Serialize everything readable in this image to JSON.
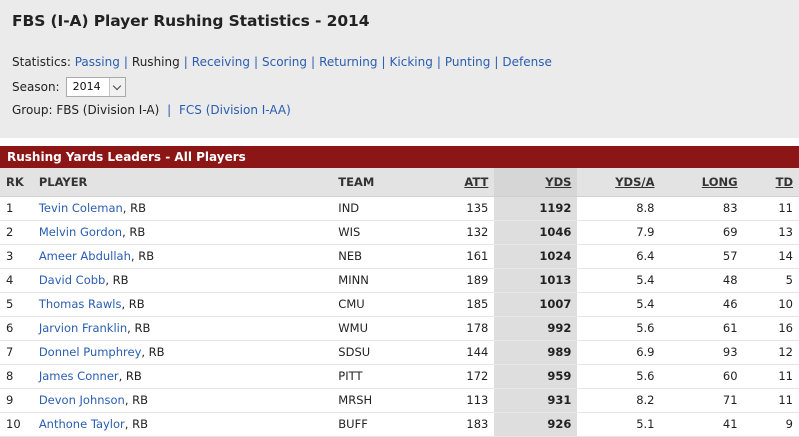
{
  "page_title": "FBS (I-A) Player Rushing Statistics - 2014",
  "statistics": {
    "label": "Statistics:",
    "links": [
      {
        "label": "Passing",
        "current": false
      },
      {
        "label": "Rushing",
        "current": true
      },
      {
        "label": "Receiving",
        "current": false
      },
      {
        "label": "Scoring",
        "current": false
      },
      {
        "label": "Returning",
        "current": false
      },
      {
        "label": "Kicking",
        "current": false
      },
      {
        "label": "Punting",
        "current": false
      },
      {
        "label": "Defense",
        "current": false
      }
    ],
    "separator": "|"
  },
  "season": {
    "label": "Season:",
    "selected": "2014"
  },
  "group": {
    "label": "Group:",
    "current": "FBS (Division I-A)",
    "separator": "|",
    "other": "FCS (Division I-AA)"
  },
  "section_title": "Rushing Yards Leaders - All Players",
  "table": {
    "columns": {
      "rk": "RK",
      "player": "PLAYER",
      "team": "TEAM",
      "att": "ATT",
      "yds": "YDS",
      "ydsa": "YDS/A",
      "long": "LONG",
      "td": "TD"
    },
    "rows": [
      {
        "rk": "1",
        "player": "Tevin Coleman",
        "pos": ", RB",
        "team": "IND",
        "att": "135",
        "yds": "1192",
        "ydsa": "8.8",
        "long": "83",
        "td": "11"
      },
      {
        "rk": "2",
        "player": "Melvin Gordon",
        "pos": ", RB",
        "team": "WIS",
        "att": "132",
        "yds": "1046",
        "ydsa": "7.9",
        "long": "69",
        "td": "13"
      },
      {
        "rk": "3",
        "player": "Ameer Abdullah",
        "pos": ", RB",
        "team": "NEB",
        "att": "161",
        "yds": "1024",
        "ydsa": "6.4",
        "long": "57",
        "td": "14"
      },
      {
        "rk": "4",
        "player": "David Cobb",
        "pos": ", RB",
        "team": "MINN",
        "att": "189",
        "yds": "1013",
        "ydsa": "5.4",
        "long": "48",
        "td": "5"
      },
      {
        "rk": "5",
        "player": "Thomas Rawls",
        "pos": ", RB",
        "team": "CMU",
        "att": "185",
        "yds": "1007",
        "ydsa": "5.4",
        "long": "46",
        "td": "10"
      },
      {
        "rk": "6",
        "player": "Jarvion Franklin",
        "pos": ", RB",
        "team": "WMU",
        "att": "178",
        "yds": "992",
        "ydsa": "5.6",
        "long": "61",
        "td": "16"
      },
      {
        "rk": "7",
        "player": "Donnel Pumphrey",
        "pos": ", RB",
        "team": "SDSU",
        "att": "144",
        "yds": "989",
        "ydsa": "6.9",
        "long": "93",
        "td": "12"
      },
      {
        "rk": "8",
        "player": "James Conner",
        "pos": ", RB",
        "team": "PITT",
        "att": "172",
        "yds": "959",
        "ydsa": "5.6",
        "long": "60",
        "td": "11"
      },
      {
        "rk": "9",
        "player": "Devon Johnson",
        "pos": ", RB",
        "team": "MRSH",
        "att": "113",
        "yds": "931",
        "ydsa": "8.2",
        "long": "71",
        "td": "11"
      },
      {
        "rk": "10",
        "player": "Anthone Taylor",
        "pos": ", RB",
        "team": "BUFF",
        "att": "183",
        "yds": "926",
        "ydsa": "5.1",
        "long": "41",
        "td": "9"
      }
    ]
  },
  "colors": {
    "section_bar": "#8c1515",
    "link": "#2a5db0",
    "header_bg": "#ebebeb"
  }
}
